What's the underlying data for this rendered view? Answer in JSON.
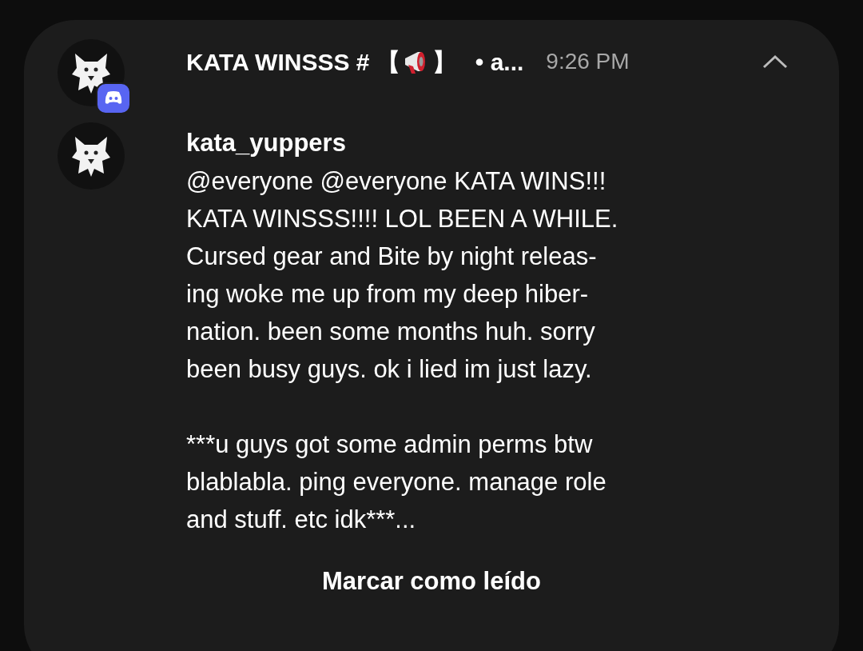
{
  "notification": {
    "title_start": "KATA WINSSS # 【",
    "title_end": "】",
    "subtext": "• a...",
    "time": "9:26 PM",
    "expanded": true
  },
  "message": {
    "sender": "kata_yuppers",
    "paragraphs": [
      "@everyone @everyone KATA WINS!!!\nKATA WINSSS!!!! LOL BEEN A WHILE.\nCursed gear and Bite by night releas-\ning woke me up from my deep hiber-\nnation. been some months huh. sorry\nbeen busy guys. ok i lied im just lazy.",
      "***u guys got some admin perms btw\nblablabla. ping everyone. manage role\nand stuff. etc idk***..."
    ]
  },
  "action": "Marcar como leído"
}
